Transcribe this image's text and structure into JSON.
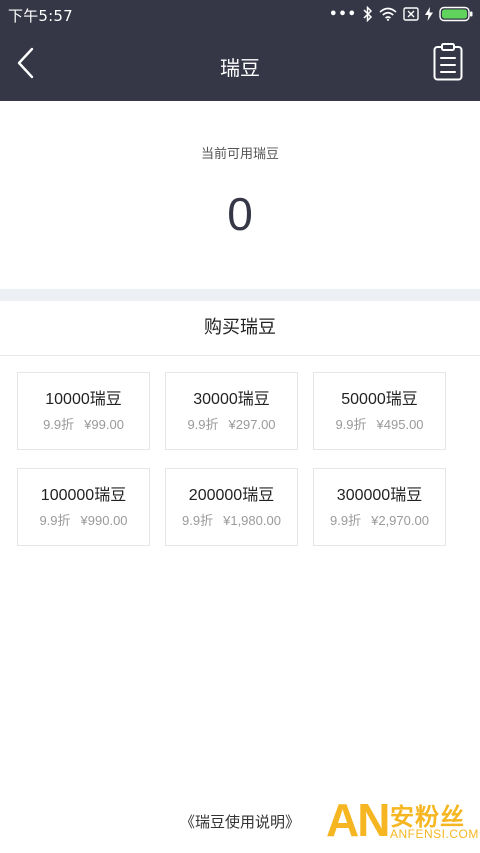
{
  "status_bar": {
    "time": "下午5:57",
    "icons": [
      "more-dots-icon",
      "bluetooth-icon",
      "wifi-icon",
      "sim-disabled-icon",
      "charging-icon",
      "battery-icon"
    ],
    "dots": "•••"
  },
  "nav": {
    "title": "瑞豆",
    "back_icon": "chevron-left-icon",
    "record_icon": "clipboard-list-icon"
  },
  "balance": {
    "label": "当前可用瑞豆",
    "value": "0"
  },
  "purchase": {
    "title": "购买瑞豆",
    "packages": [
      {
        "name": "10000瑞豆",
        "discount": "9.9折",
        "price": "¥99.00"
      },
      {
        "name": "30000瑞豆",
        "discount": "9.9折",
        "price": "¥297.00"
      },
      {
        "name": "50000瑞豆",
        "discount": "9.9折",
        "price": "¥495.00"
      },
      {
        "name": "100000瑞豆",
        "discount": "9.9折",
        "price": "¥990.00"
      },
      {
        "name": "200000瑞豆",
        "discount": "9.9折",
        "price": "¥1,980.00"
      },
      {
        "name": "300000瑞豆",
        "discount": "9.9折",
        "price": "¥2,970.00"
      }
    ]
  },
  "footer": {
    "link": "《瑞豆使用说明》"
  },
  "watermark": {
    "logo": "AN",
    "name_cn": "安粉丝",
    "name_en": "ANFENSI.COM"
  },
  "colors": {
    "header_bg": "#353646",
    "divider_band": "#eceff3",
    "watermark": "#f6b622"
  }
}
